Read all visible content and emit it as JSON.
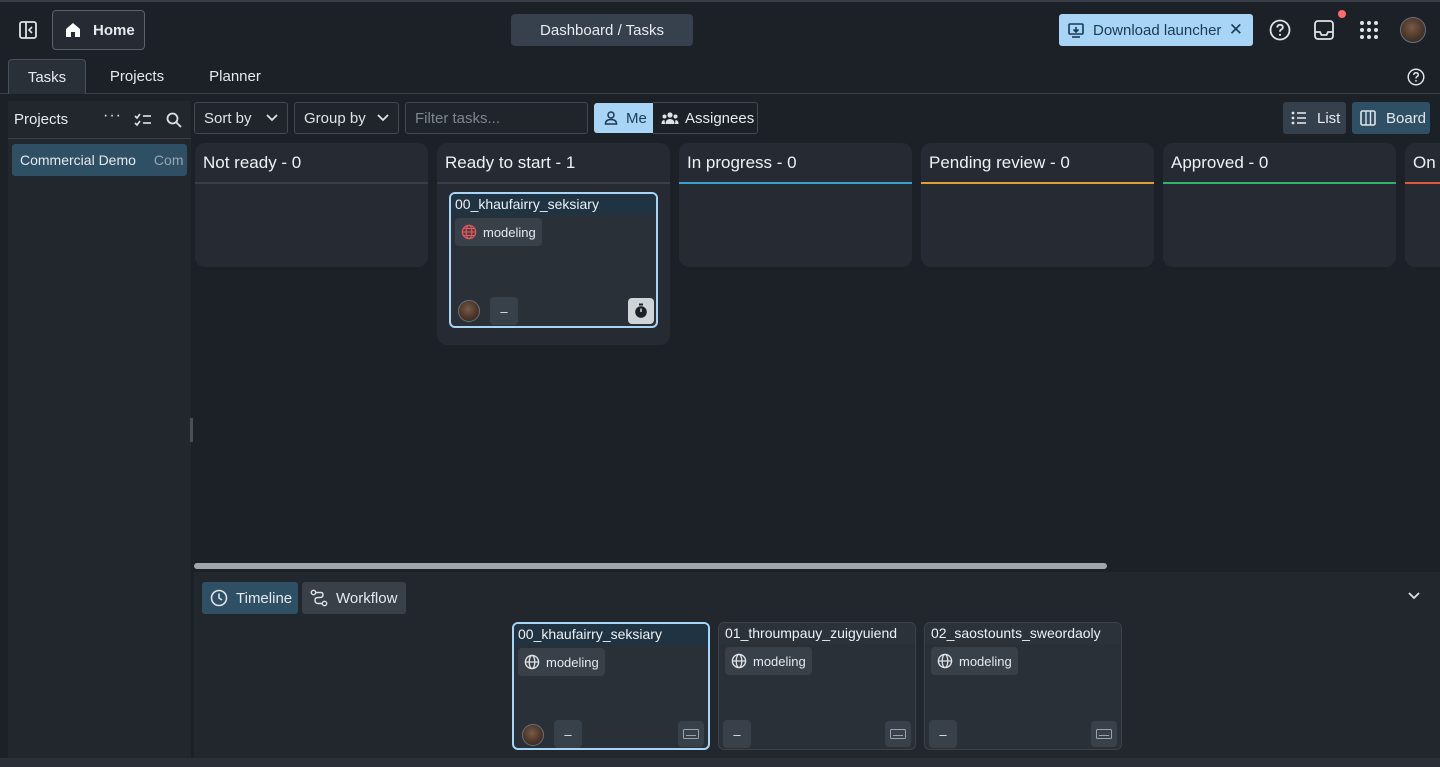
{
  "header": {
    "home_label": "Home",
    "breadcrumb": "Dashboard / Tasks",
    "download_label": "Download launcher",
    "icons": [
      "sidebar-toggle-icon",
      "home-icon",
      "download-icon",
      "close-icon",
      "help-icon",
      "inbox-icon",
      "apps-grid-icon"
    ]
  },
  "tabs": [
    {
      "label": "Tasks",
      "active": true
    },
    {
      "label": "Projects",
      "active": false
    },
    {
      "label": "Planner",
      "active": false
    }
  ],
  "left_panel": {
    "title": "Projects",
    "items": [
      {
        "name": "Commercial Demo",
        "code": "Com"
      }
    ]
  },
  "toolbar": {
    "sort_label": "Sort by",
    "group_label": "Group by",
    "filter_placeholder": "Filter tasks...",
    "me_label": "Me",
    "assignees_label": "Assignees",
    "list_label": "List",
    "board_label": "Board"
  },
  "board": {
    "columns": [
      {
        "title": "Not ready - 0",
        "color": "#3a3f47"
      },
      {
        "title": "Ready to start - 1",
        "color": "#3a3f47"
      },
      {
        "title": "In progress - 0",
        "color": "#3aa0d0"
      },
      {
        "title": "Pending review - 0",
        "color": "#e0a030"
      },
      {
        "title": "Approved - 0",
        "color": "#2fb36b"
      },
      {
        "title": "On",
        "color": "#e05a3a"
      }
    ],
    "card": {
      "title": "00_khaufairry_seksiary",
      "tag": "modeling",
      "assignee_value": "–"
    }
  },
  "bottom_panel": {
    "timeline_label": "Timeline",
    "workflow_label": "Workflow",
    "cards": [
      {
        "title": "00_khaufairry_seksiary",
        "tag": "modeling",
        "value": "–"
      },
      {
        "title": "01_throumpauy_zuigyuiend",
        "tag": "modeling",
        "value": "–"
      },
      {
        "title": "02_saostounts_sweordaoly",
        "tag": "modeling",
        "value": "–"
      }
    ]
  },
  "colors": {
    "accent": "#a8d5f5",
    "background": "#1c2027",
    "panel": "#22272e"
  }
}
